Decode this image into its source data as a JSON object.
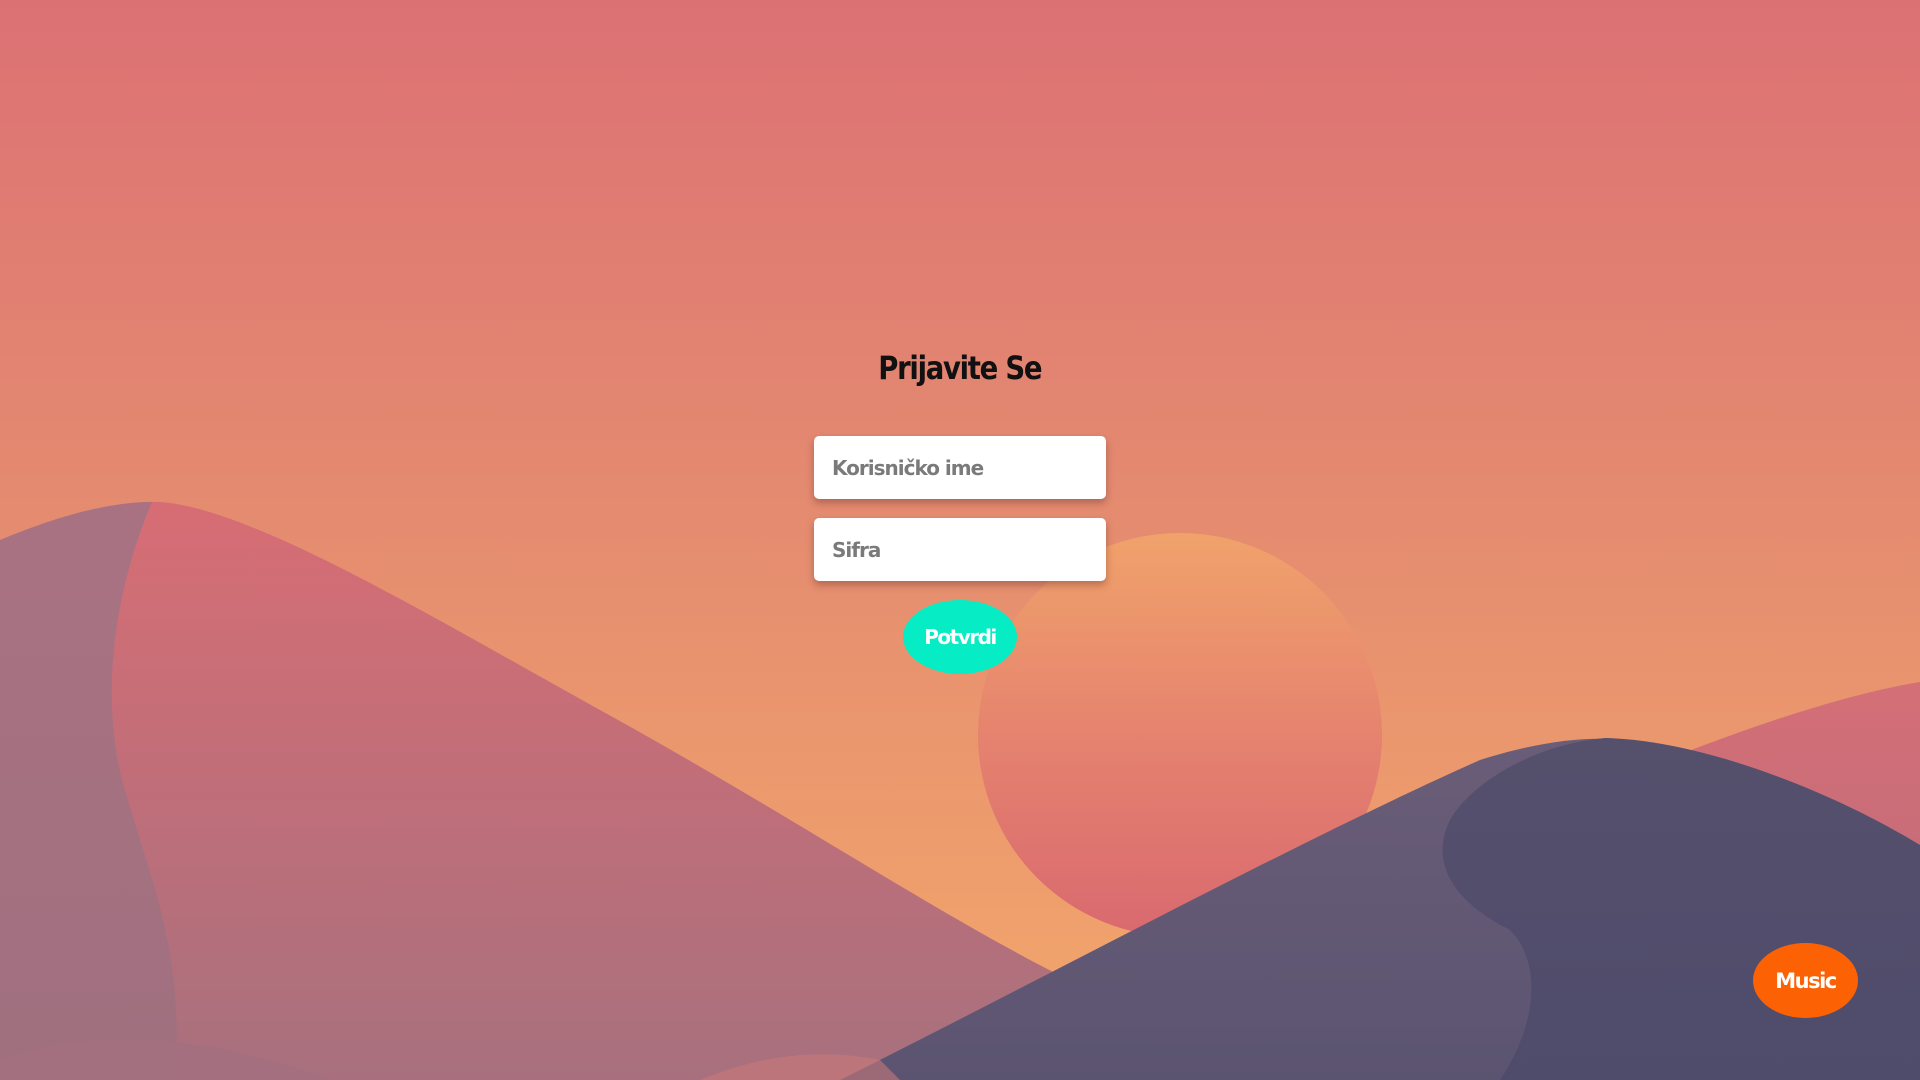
{
  "login": {
    "title": "Prijavite Se",
    "username_placeholder": "Korisničko ime",
    "username_value": "",
    "password_placeholder": "Sifra",
    "password_value": "",
    "submit_label": "Potvrdi"
  },
  "music_button": {
    "label": "Music"
  },
  "colors": {
    "sky_top": "#dc7174",
    "sky_bottom": "#f1a46c",
    "sun": "#ee9d6b",
    "submit_button": "#06ecc4",
    "music_button": "#fc6204",
    "dune_dark": "#5a5470"
  }
}
